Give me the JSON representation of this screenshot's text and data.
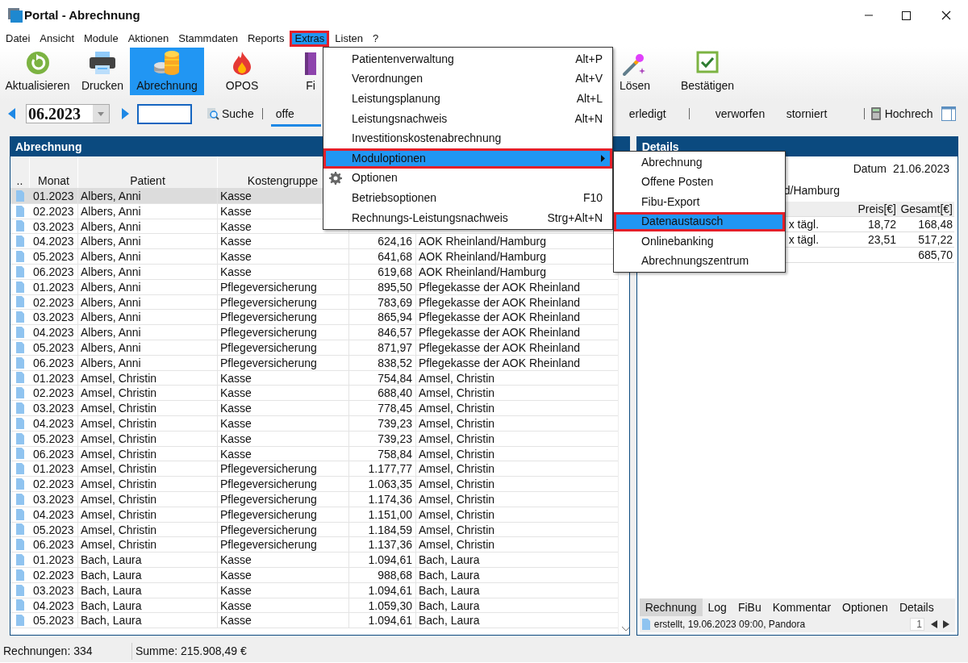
{
  "window": {
    "title": "Portal - Abrechnung"
  },
  "menu_bar": [
    {
      "label": "Datei",
      "selected": false
    },
    {
      "label": "Ansicht",
      "selected": false
    },
    {
      "label": "Module",
      "selected": false
    },
    {
      "label": "Aktionen",
      "selected": false
    },
    {
      "label": "Stammdaten",
      "selected": false
    },
    {
      "label": "Reports",
      "selected": false
    },
    {
      "label": "Extras",
      "selected": true
    },
    {
      "label": "Listen",
      "selected": false
    },
    {
      "label": "?",
      "selected": false
    }
  ],
  "toolbar": [
    {
      "label": "Aktualisieren",
      "kind": "refresh",
      "selected": false
    },
    {
      "label": "Drucken",
      "kind": "print",
      "selected": false
    },
    {
      "label": "Abrechnung",
      "kind": "coins",
      "selected": true
    },
    {
      "label": "OPOS",
      "kind": "flame",
      "selected": false
    },
    {
      "label": "Fi",
      "kind": "book",
      "selected": false
    },
    {
      "label": "Lösen",
      "kind": "wand",
      "selected": false
    },
    {
      "label": "Bestätigen",
      "kind": "check",
      "selected": false
    }
  ],
  "period": {
    "value": "06.2023"
  },
  "search_button": "Suche",
  "status_tabs": [
    {
      "label": "offe",
      "selected": true
    },
    {
      "label": "erledigt",
      "selected": false
    },
    {
      "label": "verworfen",
      "selected": false
    },
    {
      "label": "storniert",
      "selected": false
    }
  ],
  "projection_button": "Hochrech",
  "list_panel": {
    "title": "Abrechnung",
    "columns": [
      "..",
      "Monat",
      "Patient",
      "Kostengruppe"
    ],
    "rows": [
      {
        "month": "01.2023",
        "patient": "Albers, Anni",
        "group": "Kasse",
        "selected": true
      },
      {
        "month": "02.2023",
        "patient": "Albers, Anni",
        "group": "Kasse",
        "selected": false
      },
      {
        "month": "03.2023",
        "patient": "Albers, Anni",
        "group": "Kasse",
        "selected": false
      },
      {
        "month": "04.2023",
        "patient": "Albers, Anni",
        "group": "Kasse",
        "amount": "624,16",
        "payer": "AOK Rheinland/Hamburg",
        "selected": false
      },
      {
        "month": "05.2023",
        "patient": "Albers, Anni",
        "group": "Kasse",
        "amount": "641,68",
        "payer": "AOK Rheinland/Hamburg",
        "selected": false
      },
      {
        "month": "06.2023",
        "patient": "Albers, Anni",
        "group": "Kasse",
        "amount": "619,68",
        "payer": "AOK Rheinland/Hamburg",
        "selected": false
      },
      {
        "month": "01.2023",
        "patient": "Albers, Anni",
        "group": "Pflegeversicherung",
        "amount": "895,50",
        "payer": "Pflegekasse der AOK Rheinland",
        "selected": false
      },
      {
        "month": "02.2023",
        "patient": "Albers, Anni",
        "group": "Pflegeversicherung",
        "amount": "783,69",
        "payer": "Pflegekasse der AOK Rheinland",
        "selected": false
      },
      {
        "month": "03.2023",
        "patient": "Albers, Anni",
        "group": "Pflegeversicherung",
        "amount": "865,94",
        "payer": "Pflegekasse der AOK Rheinland",
        "selected": false
      },
      {
        "month": "04.2023",
        "patient": "Albers, Anni",
        "group": "Pflegeversicherung",
        "amount": "846,57",
        "payer": "Pflegekasse der AOK Rheinland",
        "selected": false
      },
      {
        "month": "05.2023",
        "patient": "Albers, Anni",
        "group": "Pflegeversicherung",
        "amount": "871,97",
        "payer": "Pflegekasse der AOK Rheinland",
        "selected": false
      },
      {
        "month": "06.2023",
        "patient": "Albers, Anni",
        "group": "Pflegeversicherung",
        "amount": "838,52",
        "payer": "Pflegekasse der AOK Rheinland",
        "selected": false
      },
      {
        "month": "01.2023",
        "patient": "Amsel, Christin",
        "group": "Kasse",
        "amount": "754,84",
        "payer": "Amsel, Christin",
        "selected": false
      },
      {
        "month": "02.2023",
        "patient": "Amsel, Christin",
        "group": "Kasse",
        "amount": "688,40",
        "payer": "Amsel, Christin",
        "selected": false
      },
      {
        "month": "03.2023",
        "patient": "Amsel, Christin",
        "group": "Kasse",
        "amount": "778,45",
        "payer": "Amsel, Christin",
        "selected": false
      },
      {
        "month": "04.2023",
        "patient": "Amsel, Christin",
        "group": "Kasse",
        "amount": "739,23",
        "payer": "Amsel, Christin",
        "selected": false
      },
      {
        "month": "05.2023",
        "patient": "Amsel, Christin",
        "group": "Kasse",
        "amount": "739,23",
        "payer": "Amsel, Christin",
        "selected": false
      },
      {
        "month": "06.2023",
        "patient": "Amsel, Christin",
        "group": "Kasse",
        "amount": "758,84",
        "payer": "Amsel, Christin",
        "selected": false
      },
      {
        "month": "01.2023",
        "patient": "Amsel, Christin",
        "group": "Pflegeversicherung",
        "amount": "1.177,77",
        "payer": "Amsel, Christin",
        "selected": false
      },
      {
        "month": "02.2023",
        "patient": "Amsel, Christin",
        "group": "Pflegeversicherung",
        "amount": "1.063,35",
        "payer": "Amsel, Christin",
        "selected": false
      },
      {
        "month": "03.2023",
        "patient": "Amsel, Christin",
        "group": "Pflegeversicherung",
        "amount": "1.174,36",
        "payer": "Amsel, Christin",
        "selected": false
      },
      {
        "month": "04.2023",
        "patient": "Amsel, Christin",
        "group": "Pflegeversicherung",
        "amount": "1.151,00",
        "payer": "Amsel, Christin",
        "selected": false
      },
      {
        "month": "05.2023",
        "patient": "Amsel, Christin",
        "group": "Pflegeversicherung",
        "amount": "1.184,59",
        "payer": "Amsel, Christin",
        "selected": false
      },
      {
        "month": "06.2023",
        "patient": "Amsel, Christin",
        "group": "Pflegeversicherung",
        "amount": "1.137,36",
        "payer": "Amsel, Christin",
        "selected": false
      },
      {
        "month": "01.2023",
        "patient": "Bach, Laura",
        "group": "Kasse",
        "amount": "1.094,61",
        "payer": "Bach, Laura",
        "selected": false
      },
      {
        "month": "02.2023",
        "patient": "Bach, Laura",
        "group": "Kasse",
        "amount": "988,68",
        "payer": "Bach, Laura",
        "selected": false
      },
      {
        "month": "03.2023",
        "patient": "Bach, Laura",
        "group": "Kasse",
        "amount": "1.094,61",
        "payer": "Bach, Laura",
        "selected": false
      },
      {
        "month": "04.2023",
        "patient": "Bach, Laura",
        "group": "Kasse",
        "amount": "1.059,30",
        "payer": "Bach, Laura",
        "selected": false
      },
      {
        "month": "05.2023",
        "patient": "Bach, Laura",
        "group": "Kasse",
        "amount": "1.094,61",
        "payer": "Bach, Laura",
        "selected": false
      }
    ]
  },
  "details_panel": {
    "title": "Details",
    "date_label": "Datum",
    "date": "21.06.2023",
    "payer": "d/Hamburg",
    "columns": [
      "Preis[€]",
      "Gesamt[€]"
    ],
    "rows": [
      {
        "text": "x tägl.",
        "price": "18,72",
        "total": "168,48"
      },
      {
        "text": "x tägl.",
        "price": "23,51",
        "total": "517,22"
      }
    ],
    "total": "685,70",
    "tabs": [
      {
        "label": "Rechnung",
        "selected": true
      },
      {
        "label": "Log",
        "selected": false
      },
      {
        "label": "FiBu",
        "selected": false
      },
      {
        "label": "Kommentar",
        "selected": false
      },
      {
        "label": "Optionen",
        "selected": false
      },
      {
        "label": "Details",
        "selected": false
      }
    ],
    "log_entry": "erstellt, 19.06.2023 09:00, Pandora",
    "page": "1"
  },
  "extras_menu": [
    {
      "label": "Patientenverwaltung",
      "shortcut": "Alt+P",
      "selected": false,
      "kind": "plain"
    },
    {
      "label": "Verordnungen",
      "shortcut": "Alt+V",
      "selected": false,
      "kind": "plain"
    },
    {
      "label": "Leistungsplanung",
      "shortcut": "Alt+L",
      "selected": false,
      "kind": "plain"
    },
    {
      "label": "Leistungsnachweis",
      "shortcut": "Alt+N",
      "selected": false,
      "kind": "plain"
    },
    {
      "label": "Investitionskostenabrechnung",
      "selected": false,
      "kind": "plain"
    },
    {
      "label": "Moduloptionen",
      "selected": true,
      "kind": "submenu"
    },
    {
      "label": "Optionen",
      "selected": false,
      "kind": "gear"
    },
    {
      "label": "Betriebsoptionen",
      "shortcut": "F10",
      "selected": false,
      "kind": "plain"
    },
    {
      "label": "Rechnungs-Leistungsnachweis",
      "shortcut": "Strg+Alt+N",
      "selected": false,
      "kind": "plain"
    }
  ],
  "submenu": [
    {
      "label": "Abrechnung",
      "selected": false
    },
    {
      "label": "Offene Posten",
      "selected": false
    },
    {
      "label": "Fibu-Export",
      "selected": false
    },
    {
      "label": "Datenaustausch",
      "selected": true
    },
    {
      "label": "Onlinebanking",
      "selected": false
    },
    {
      "label": "Abrechnungszentrum",
      "selected": false
    }
  ],
  "status_bar": [
    "Rechnungen: 334",
    "Summe: 215.908,49 €"
  ]
}
